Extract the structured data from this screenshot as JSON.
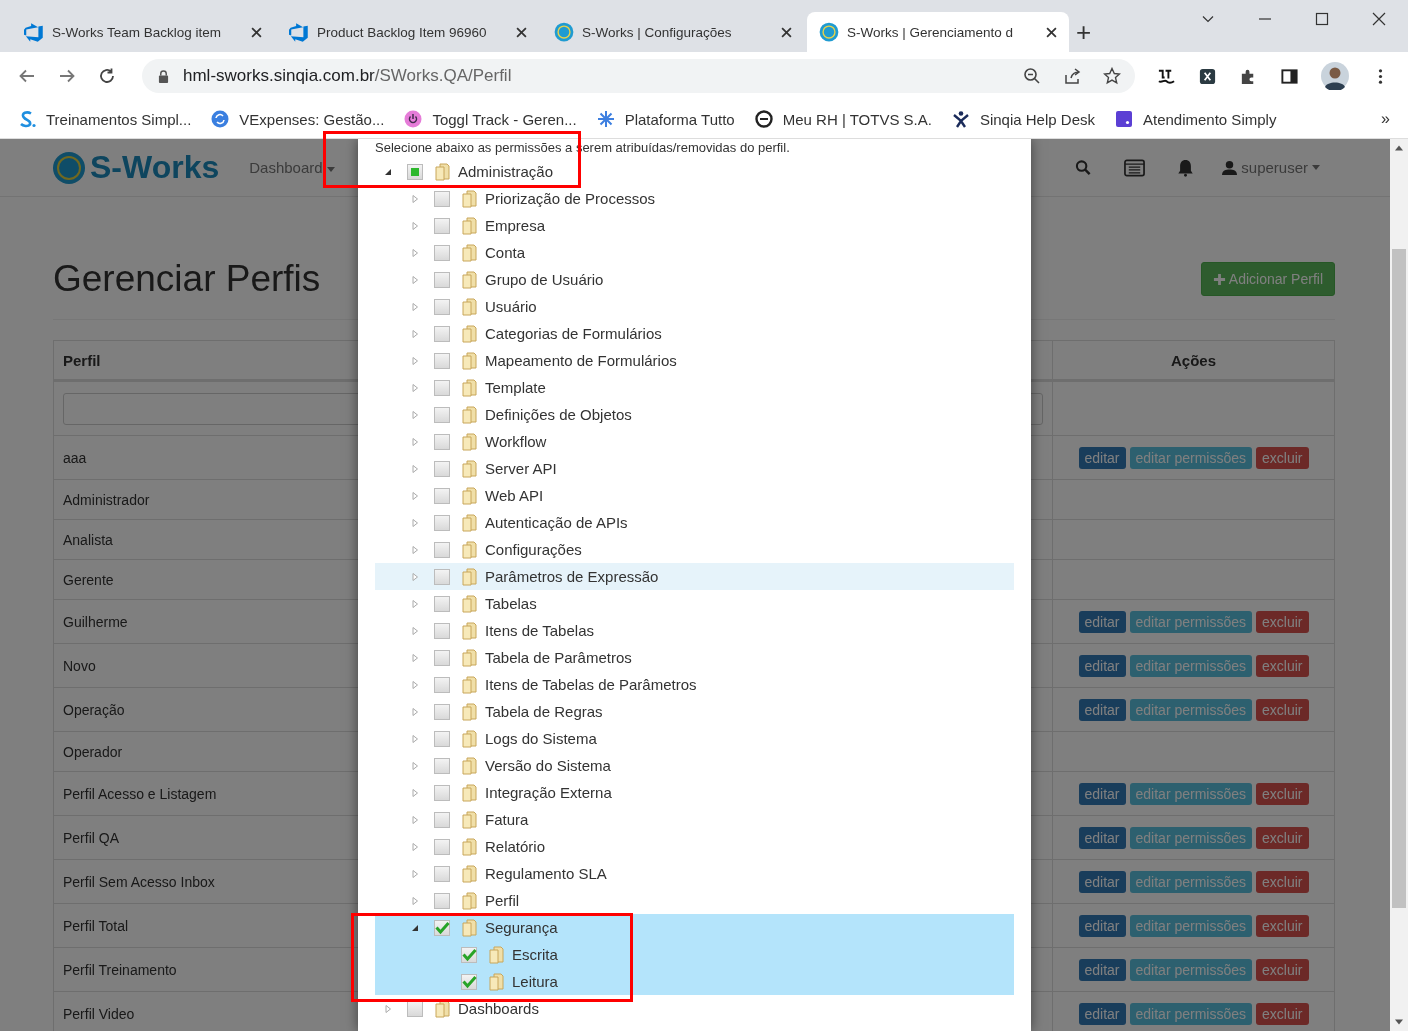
{
  "browser": {
    "tabs": [
      {
        "title": "S-Works Team Backlog item",
        "kind": "devops",
        "selected": false
      },
      {
        "title": "Product Backlog Item 96960",
        "kind": "devops",
        "selected": false
      },
      {
        "title": "S-Works | Configurações",
        "kind": "sworks",
        "selected": false
      },
      {
        "title": "S-Works | Gerenciamento d",
        "kind": "sworks",
        "selected": true
      }
    ],
    "new_tab": "+",
    "address": {
      "host": "hml-sworks.sinqia.com.br",
      "path": "/SWorks.QA/Perfil"
    },
    "bookmarks": [
      {
        "label": "Treinamentos Simpl..."
      },
      {
        "label": "VExpenses: Gestão..."
      },
      {
        "label": "Toggl Track - Geren..."
      },
      {
        "label": "Plataforma Tutto"
      },
      {
        "label": "Meu RH | TOTVS S.A."
      },
      {
        "label": "Sinqia Help Desk"
      },
      {
        "label": "Atendimento Simply"
      }
    ],
    "bookmarks_more": "»"
  },
  "app": {
    "brand": "S-Works",
    "nav": [
      {
        "label": "Dashboard"
      }
    ],
    "user": "superuser",
    "page_title": "Gerenciar Perfis",
    "add_button": "Adicionar Perfil",
    "table": {
      "columns": [
        "Perfil",
        "Ações"
      ],
      "rows": [
        {
          "name": "aaa",
          "actions": [
            "editar",
            "editar permissões",
            "excluir"
          ]
        },
        {
          "name": "Administrador"
        },
        {
          "name": "Analista"
        },
        {
          "name": "Gerente"
        },
        {
          "name": "Guilherme",
          "actions": [
            "editar",
            "editar permissões",
            "excluir"
          ]
        },
        {
          "name": "Novo",
          "actions": [
            "editar",
            "editar permissões",
            "excluir"
          ]
        },
        {
          "name": "Operação",
          "actions": [
            "editar",
            "editar permissões",
            "excluir"
          ]
        },
        {
          "name": "Operador"
        },
        {
          "name": "Perfil Acesso e Listagem",
          "actions": [
            "editar",
            "editar permissões",
            "excluir"
          ]
        },
        {
          "name": "Perfil QA",
          "actions": [
            "editar",
            "editar permissões",
            "excluir"
          ]
        },
        {
          "name": "Perfil Sem Acesso Inbox",
          "actions": [
            "editar",
            "editar permissões",
            "excluir"
          ]
        },
        {
          "name": "Perfil Total",
          "actions": [
            "editar",
            "editar permissões",
            "excluir"
          ]
        },
        {
          "name": "Perfil Treinamento",
          "actions": [
            "editar",
            "editar permissões",
            "excluir"
          ]
        },
        {
          "name": "Perfil Video",
          "actions": [
            "editar",
            "editar permissões",
            "excluir"
          ]
        }
      ]
    }
  },
  "modal": {
    "intro": "Selecione abaixo as permissões a serem atribuídas/removidas do perfil.",
    "tree": [
      {
        "label": "Administração",
        "checked": false,
        "partial": true,
        "expanded": true,
        "selected": false,
        "children": [
          {
            "label": "Priorização de Processos",
            "checked": false,
            "partial": false,
            "expanded": false,
            "selected": false
          },
          {
            "label": "Empresa",
            "checked": false,
            "partial": false,
            "expanded": false,
            "selected": false
          },
          {
            "label": "Conta",
            "checked": false,
            "partial": false,
            "expanded": false,
            "selected": false
          },
          {
            "label": "Grupo de Usuário",
            "checked": false,
            "partial": false,
            "expanded": false,
            "selected": false
          },
          {
            "label": "Usuário",
            "checked": false,
            "partial": false,
            "expanded": false,
            "selected": false
          },
          {
            "label": "Categorias de Formulários",
            "checked": false,
            "partial": false,
            "expanded": false,
            "selected": false
          },
          {
            "label": "Mapeamento de Formulários",
            "checked": false,
            "partial": false,
            "expanded": false,
            "selected": false
          },
          {
            "label": "Template",
            "checked": false,
            "partial": false,
            "expanded": false,
            "selected": false
          },
          {
            "label": "Definições de Objetos",
            "checked": false,
            "partial": false,
            "expanded": false,
            "selected": false
          },
          {
            "label": "Workflow",
            "checked": false,
            "partial": false,
            "expanded": false,
            "selected": false
          },
          {
            "label": "Server API",
            "checked": false,
            "partial": false,
            "expanded": false,
            "selected": false
          },
          {
            "label": "Web API",
            "checked": false,
            "partial": false,
            "expanded": false,
            "selected": false
          },
          {
            "label": "Autenticação de APIs",
            "checked": false,
            "partial": false,
            "expanded": false,
            "selected": false
          },
          {
            "label": "Configurações",
            "checked": false,
            "partial": false,
            "expanded": false,
            "selected": false
          },
          {
            "label": "Parâmetros de Expressão",
            "checked": false,
            "partial": false,
            "expanded": false,
            "selected": false,
            "hovered": true
          },
          {
            "label": "Tabelas",
            "checked": false,
            "partial": false,
            "expanded": false,
            "selected": false
          },
          {
            "label": "Itens de Tabelas",
            "checked": false,
            "partial": false,
            "expanded": false,
            "selected": false
          },
          {
            "label": "Tabela de Parâmetros",
            "checked": false,
            "partial": false,
            "expanded": false,
            "selected": false
          },
          {
            "label": "Itens de Tabelas de Parâmetros",
            "checked": false,
            "partial": false,
            "expanded": false,
            "selected": false
          },
          {
            "label": "Tabela de Regras",
            "checked": false,
            "partial": false,
            "expanded": false,
            "selected": false
          },
          {
            "label": "Logs do Sistema",
            "checked": false,
            "partial": false,
            "expanded": false,
            "selected": false
          },
          {
            "label": "Versão do Sistema",
            "checked": false,
            "partial": false,
            "expanded": false,
            "selected": false
          },
          {
            "label": "Integração Externa",
            "checked": false,
            "partial": false,
            "expanded": false,
            "selected": false
          },
          {
            "label": "Fatura",
            "checked": false,
            "partial": false,
            "expanded": false,
            "selected": false
          },
          {
            "label": "Relatório",
            "checked": false,
            "partial": false,
            "expanded": false,
            "selected": false
          },
          {
            "label": "Regulamento SLA",
            "checked": false,
            "partial": false,
            "expanded": false,
            "selected": false
          },
          {
            "label": "Perfil",
            "checked": false,
            "partial": false,
            "expanded": false,
            "selected": false
          },
          {
            "label": "Segurança",
            "checked": true,
            "partial": false,
            "expanded": true,
            "selected": true,
            "children": [
              {
                "label": "Escrita",
                "checked": true,
                "partial": false,
                "selected": true
              },
              {
                "label": "Leitura",
                "checked": true,
                "partial": false,
                "selected": true
              }
            ]
          }
        ]
      },
      {
        "label": "Dashboards",
        "checked": false,
        "partial": false,
        "expanded": false,
        "selected": false
      }
    ]
  }
}
